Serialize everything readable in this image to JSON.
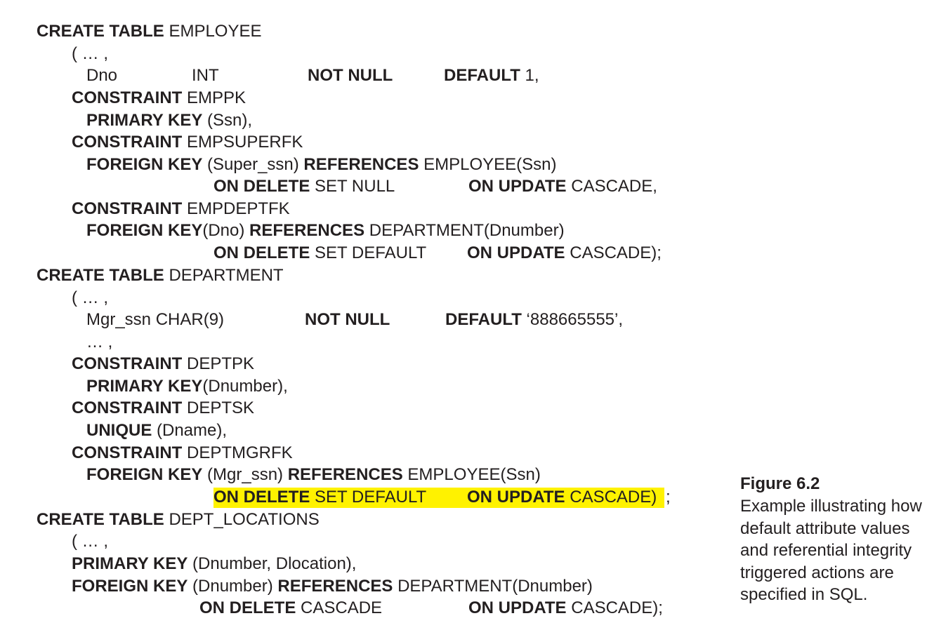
{
  "sql": {
    "l1": {
      "kw": "CREATE TABLE",
      "rest": " EMPLOYEE"
    },
    "l2": {
      "text": "( … ,"
    },
    "l3": {
      "col": "Dno",
      "type": "INT",
      "notnull": "NOT NULL",
      "default_kw": "DEFAULT",
      "default_val": " 1,"
    },
    "l4": {
      "kw": "CONSTRAINT",
      "rest": " EMPPK"
    },
    "l5": {
      "kw": "PRIMARY KEY",
      "rest": " (Ssn),"
    },
    "l6": {
      "kw": "CONSTRAINT",
      "rest": " EMPSUPERFK"
    },
    "l7": {
      "kw": "FOREIGN KEY",
      "mid": " (Super_ssn) ",
      "kw2": "REFERENCES",
      "rest": " EMPLOYEE(Ssn)"
    },
    "l8": {
      "kw": "ON DELETE",
      "rest": " SET NULL",
      "kw2": "ON UPDATE",
      "rest2": " CASCADE,"
    },
    "l9": {
      "kw": "CONSTRAINT",
      "rest": " EMPDEPTFK"
    },
    "l10": {
      "kw": "FOREIGN KEY",
      "mid": "(Dno) ",
      "kw2": "REFERENCES",
      "rest": " DEPARTMENT(Dnumber)"
    },
    "l11": {
      "kw": "ON DELETE",
      "rest": " SET DEFAULT",
      "kw2": "ON UPDATE",
      "rest2": " CASCADE);"
    },
    "l12": {
      "kw": "CREATE TABLE",
      "rest": " DEPARTMENT"
    },
    "l13": {
      "text": "( … ,"
    },
    "l14": {
      "col": "Mgr_ssn CHAR(9)",
      "notnull": "NOT NULL",
      "default_kw": "DEFAULT",
      "default_val": " ‘888665555’,"
    },
    "l15": {
      "text": "… ,"
    },
    "l16": {
      "kw": "CONSTRAINT",
      "rest": " DEPTPK"
    },
    "l17": {
      "kw": "PRIMARY KEY",
      "rest": "(Dnumber),"
    },
    "l18": {
      "kw": "CONSTRAINT",
      "rest": " DEPTSK"
    },
    "l19": {
      "kw": "UNIQUE",
      "rest": " (Dname),"
    },
    "l20": {
      "kw": "CONSTRAINT",
      "rest": " DEPTMGRFK"
    },
    "l21": {
      "kw": "FOREIGN KEY",
      "mid": " (Mgr_ssn) ",
      "kw2": "REFERENCES",
      "rest": " EMPLOYEE(Ssn)"
    },
    "l22": {
      "kw": "ON DELETE",
      "rest": " SET DEFAULT",
      "kw2": "ON UPDATE",
      "rest2": " CASCADE)",
      "tail": ";"
    },
    "l23": {
      "kw": "CREATE TABLE",
      "rest": " DEPT_LOCATIONS"
    },
    "l24": {
      "text": "( … ,"
    },
    "l25": {
      "kw": "PRIMARY KEY",
      "rest": " (Dnumber, Dlocation),"
    },
    "l26": {
      "kw": "FOREIGN KEY",
      "mid": " (Dnumber) ",
      "kw2": "REFERENCES",
      "rest": " DEPARTMENT(Dnumber)"
    },
    "l27": {
      "kw": "ON DELETE",
      "rest": " CASCADE",
      "kw2": "ON UPDATE",
      "rest2": " CASCADE);"
    }
  },
  "highlight_color": "#fff200",
  "caption": {
    "title": "Figure 6.2",
    "body": "Example illustrating how default attribute values and referential integrity triggered actions are specified in SQL."
  }
}
